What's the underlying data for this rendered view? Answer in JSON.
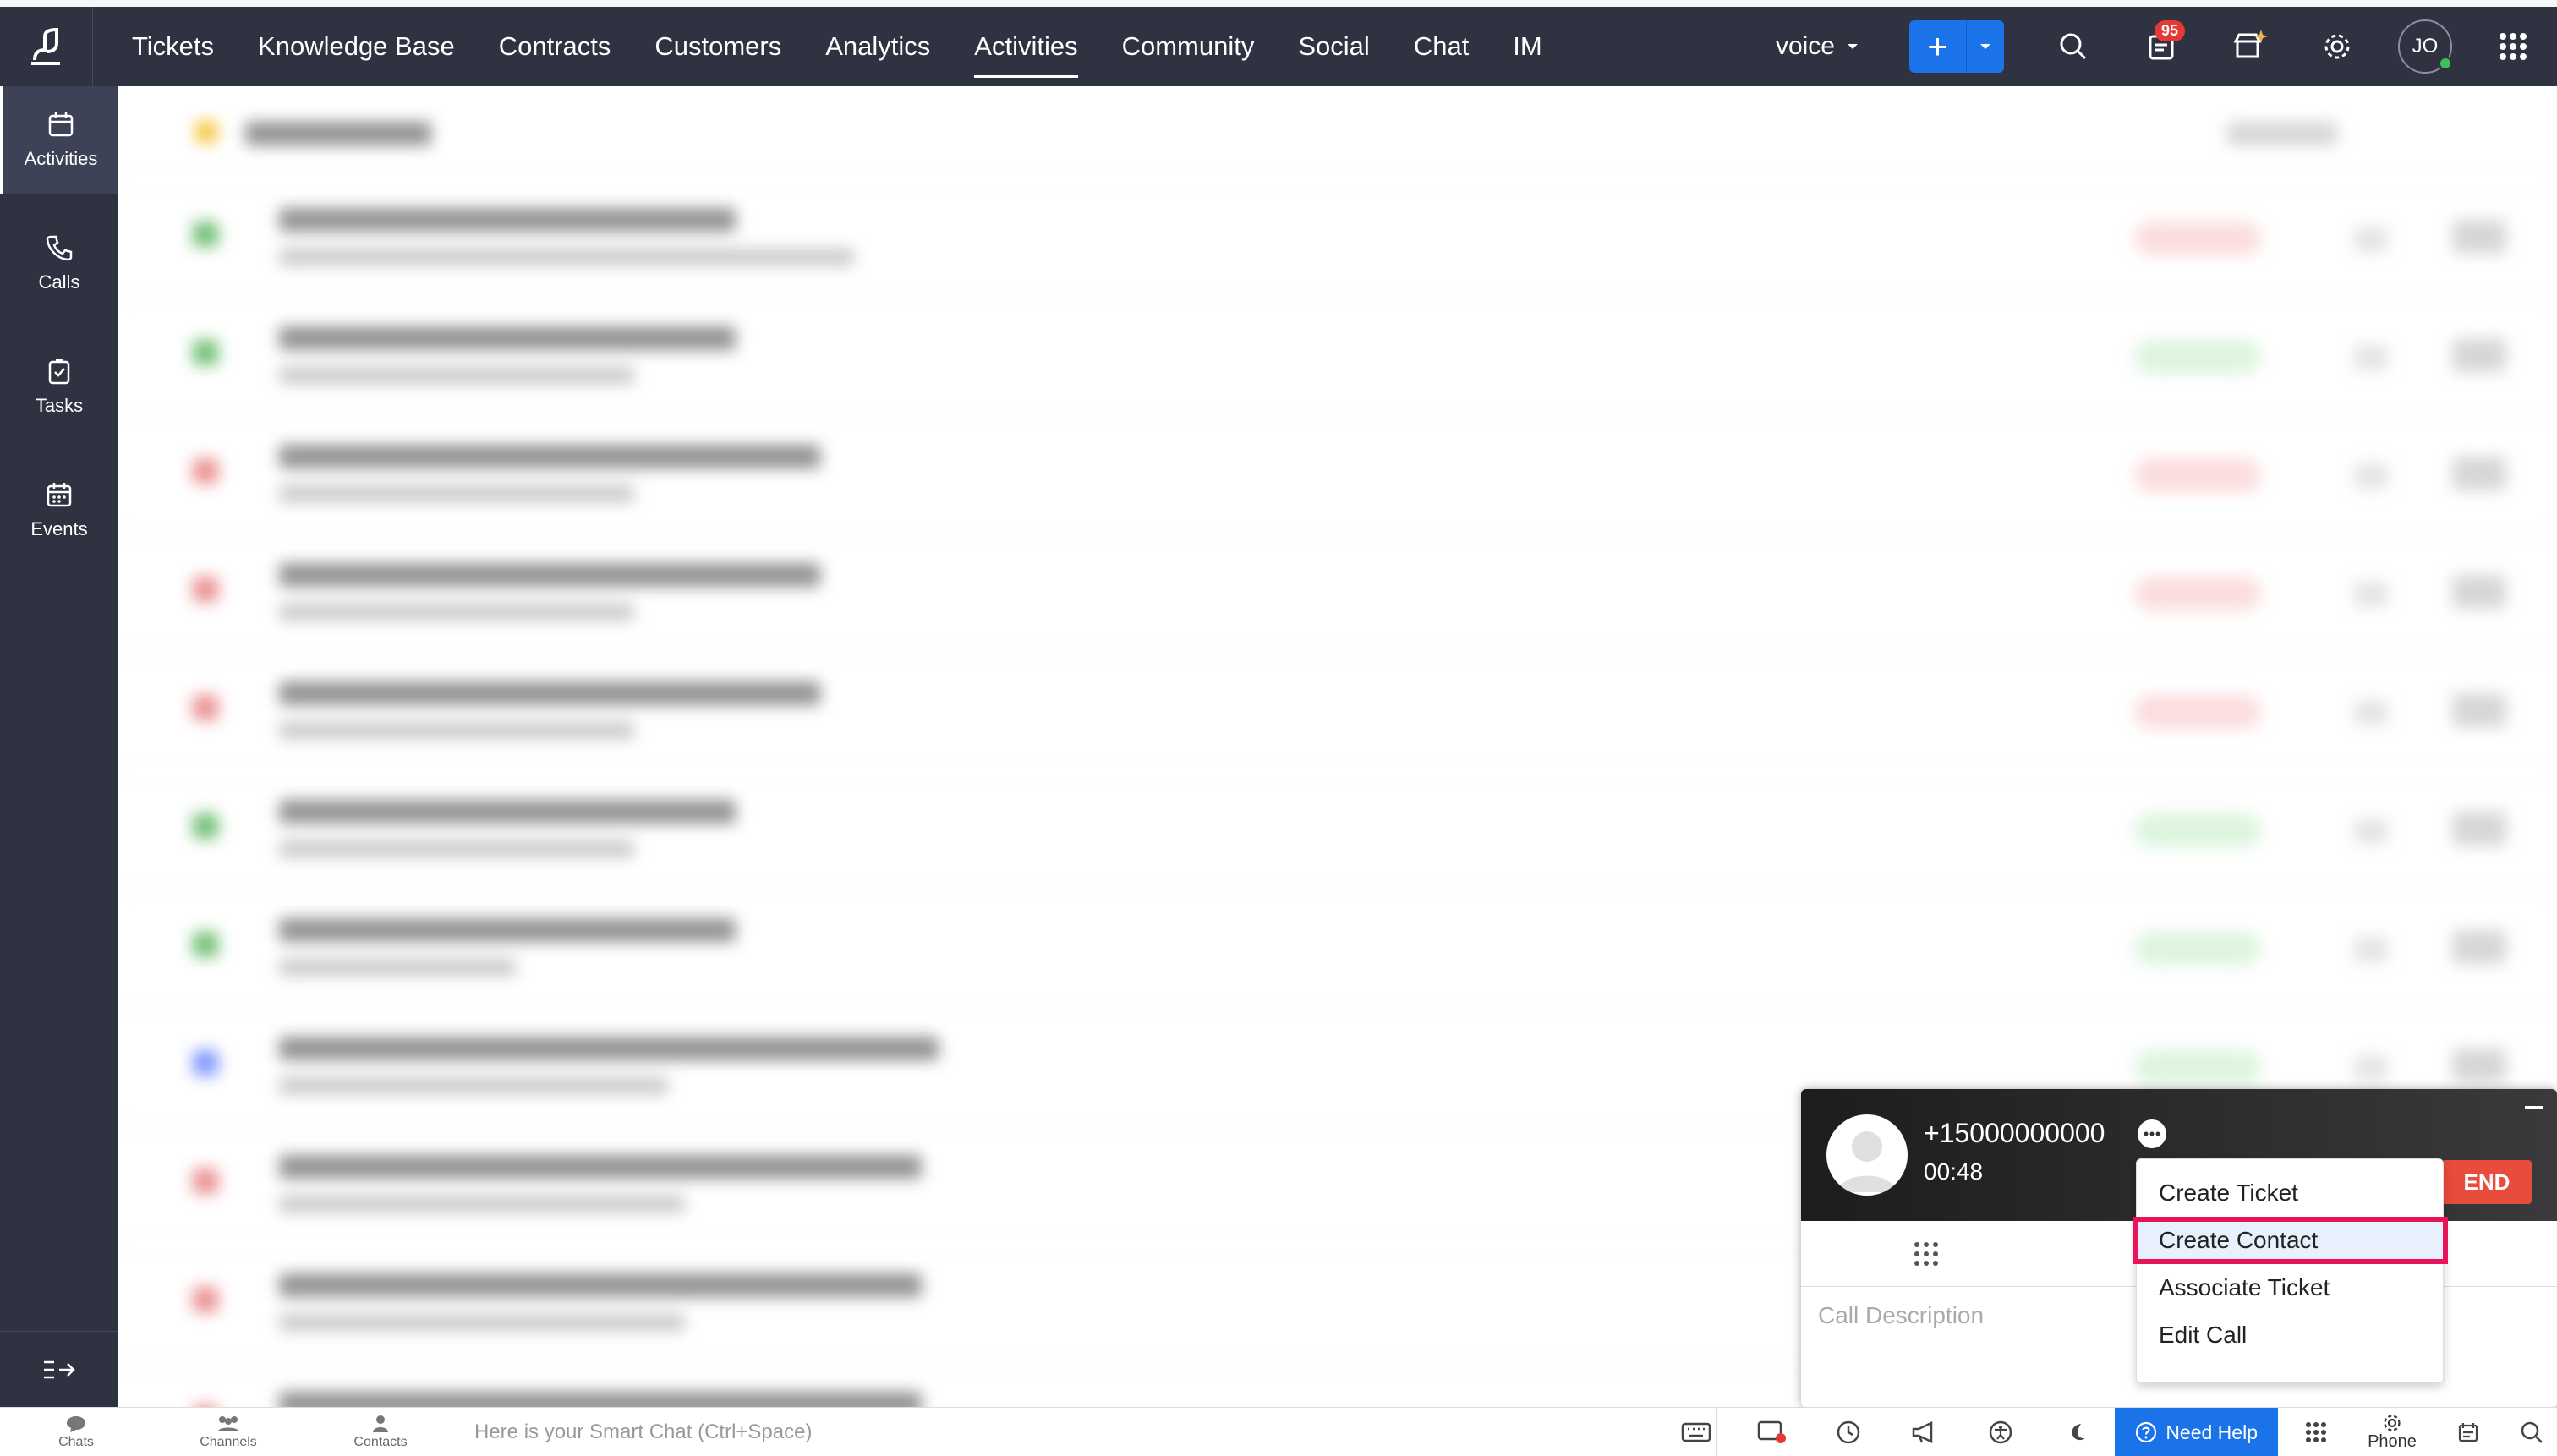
{
  "nav": {
    "items": [
      {
        "label": "Tickets",
        "active": false
      },
      {
        "label": "Knowledge Base",
        "active": false
      },
      {
        "label": "Contracts",
        "active": false
      },
      {
        "label": "Customers",
        "active": false
      },
      {
        "label": "Analytics",
        "active": false
      },
      {
        "label": "Activities",
        "active": true
      },
      {
        "label": "Community",
        "active": false
      },
      {
        "label": "Social",
        "active": false
      },
      {
        "label": "Chat",
        "active": false
      },
      {
        "label": "IM",
        "active": false
      }
    ],
    "department": "voice",
    "notification_count": "95",
    "user_initials": "JO",
    "accent_color": "#1a73e8",
    "bar_color": "#2f3241"
  },
  "sidebar": {
    "items": [
      {
        "label": "Activities",
        "icon": "calendar-icon",
        "active": true
      },
      {
        "label": "Calls",
        "icon": "phone-icon",
        "active": false
      },
      {
        "label": "Tasks",
        "icon": "task-icon",
        "active": false
      },
      {
        "label": "Events",
        "icon": "events-icon",
        "active": false
      }
    ]
  },
  "bottombar": {
    "chats": "Chats",
    "channels": "Channels",
    "contacts": "Contacts",
    "smartchat_placeholder": "Here is your Smart Chat (Ctrl+Space)",
    "need_help": "Need Help",
    "phone": "Phone"
  },
  "call": {
    "number": "+15000000000",
    "duration": "00:48",
    "end_label": "END",
    "description_placeholder": "Call Description",
    "end_color": "#e74c3c"
  },
  "menu": {
    "items": [
      {
        "label": "Create Ticket",
        "highlight": false
      },
      {
        "label": "Create Contact",
        "highlight": true
      },
      {
        "label": "Associate Ticket",
        "highlight": false
      },
      {
        "label": "Edit Call",
        "highlight": false
      }
    ],
    "highlight_color": "#e8145a"
  }
}
